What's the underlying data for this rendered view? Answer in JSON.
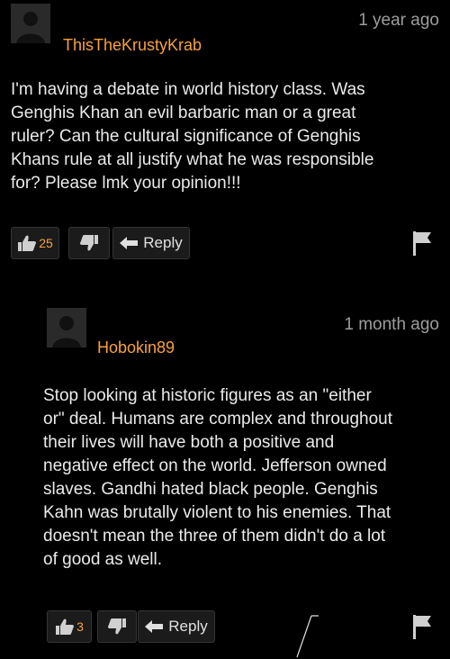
{
  "comments": [
    {
      "username": "ThisTheKrustyKrab",
      "time": "1 year ago",
      "body": "I'm having a debate in world history class. Was\nGenghis Khan an evil barbaric man or a great\nruler? Can the cultural significance of Genghis\nKhans rule at all justify what he was responsible\nfor? Please lmk your opinion!!!",
      "likes": "25",
      "reply_label": "Reply"
    },
    {
      "username": "Hobokin89",
      "time": "1 month ago",
      "body": "Stop looking at historic figures as an \"either\nor\" deal. Humans are complex and throughout\ntheir lives will have both a positive and\nnegative effect on the world. Jefferson owned\nslaves. Gandhi hated black people. Genghis\nKahn was brutally violent to his enemies. That\ndoesn't mean the three of them didn't do a lot\nof good as well.",
      "likes": "3",
      "reply_label": "Reply"
    }
  ],
  "icons": {
    "like": "thumbs-up-icon",
    "dislike": "thumbs-down-icon",
    "reply": "reply-arrow-icon",
    "flag": "flag-icon"
  },
  "colors": {
    "background": "#000000",
    "username": "#f7a23b",
    "text": "#eaeaea",
    "muted": "#9d9d9d",
    "button": "#1b1b1b"
  }
}
